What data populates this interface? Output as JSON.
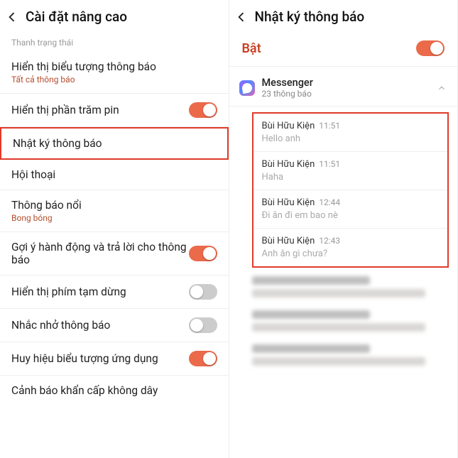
{
  "left": {
    "title": "Cài đặt nâng cao",
    "section": "Thanh trạng thái",
    "rows": {
      "show_icons": {
        "title": "Hiển thị biểu tượng thông báo",
        "sub": "Tất cả thông báo"
      },
      "battery": {
        "title": "Hiển thị phần trăm pin"
      },
      "history": {
        "title": "Nhật ký thông báo"
      },
      "convo": {
        "title": "Hội thoại"
      },
      "floating": {
        "title": "Thông báo nổi",
        "sub": "Bong bóng"
      },
      "suggest": {
        "title": "Gợi ý hành động và trả lời cho thông báo"
      },
      "pause": {
        "title": "Hiển thị phím tạm dừng"
      },
      "remind": {
        "title": "Nhắc nhở thông báo"
      },
      "badge": {
        "title": "Huy hiệu biểu tượng ứng dụng"
      },
      "emergency": {
        "title": "Cảnh báo khẩn cấp không dây"
      }
    }
  },
  "right": {
    "title": "Nhật ký thông báo",
    "enable": "Bật",
    "app": {
      "name": "Messenger",
      "count": "23 thông báo"
    },
    "notifs": [
      {
        "sender": "Bùi Hữu Kiện",
        "time": "11:51",
        "msg": "Hello anh"
      },
      {
        "sender": "Bùi Hữu Kiện",
        "time": "11:51",
        "msg": "Haha"
      },
      {
        "sender": "Bùi Hữu Kiện",
        "time": "12:44",
        "msg": "Đi ăn đi em bao nè"
      },
      {
        "sender": "Bùi Hữu Kiện",
        "time": "12:43",
        "msg": "Anh ăn gì chưa?"
      }
    ]
  }
}
